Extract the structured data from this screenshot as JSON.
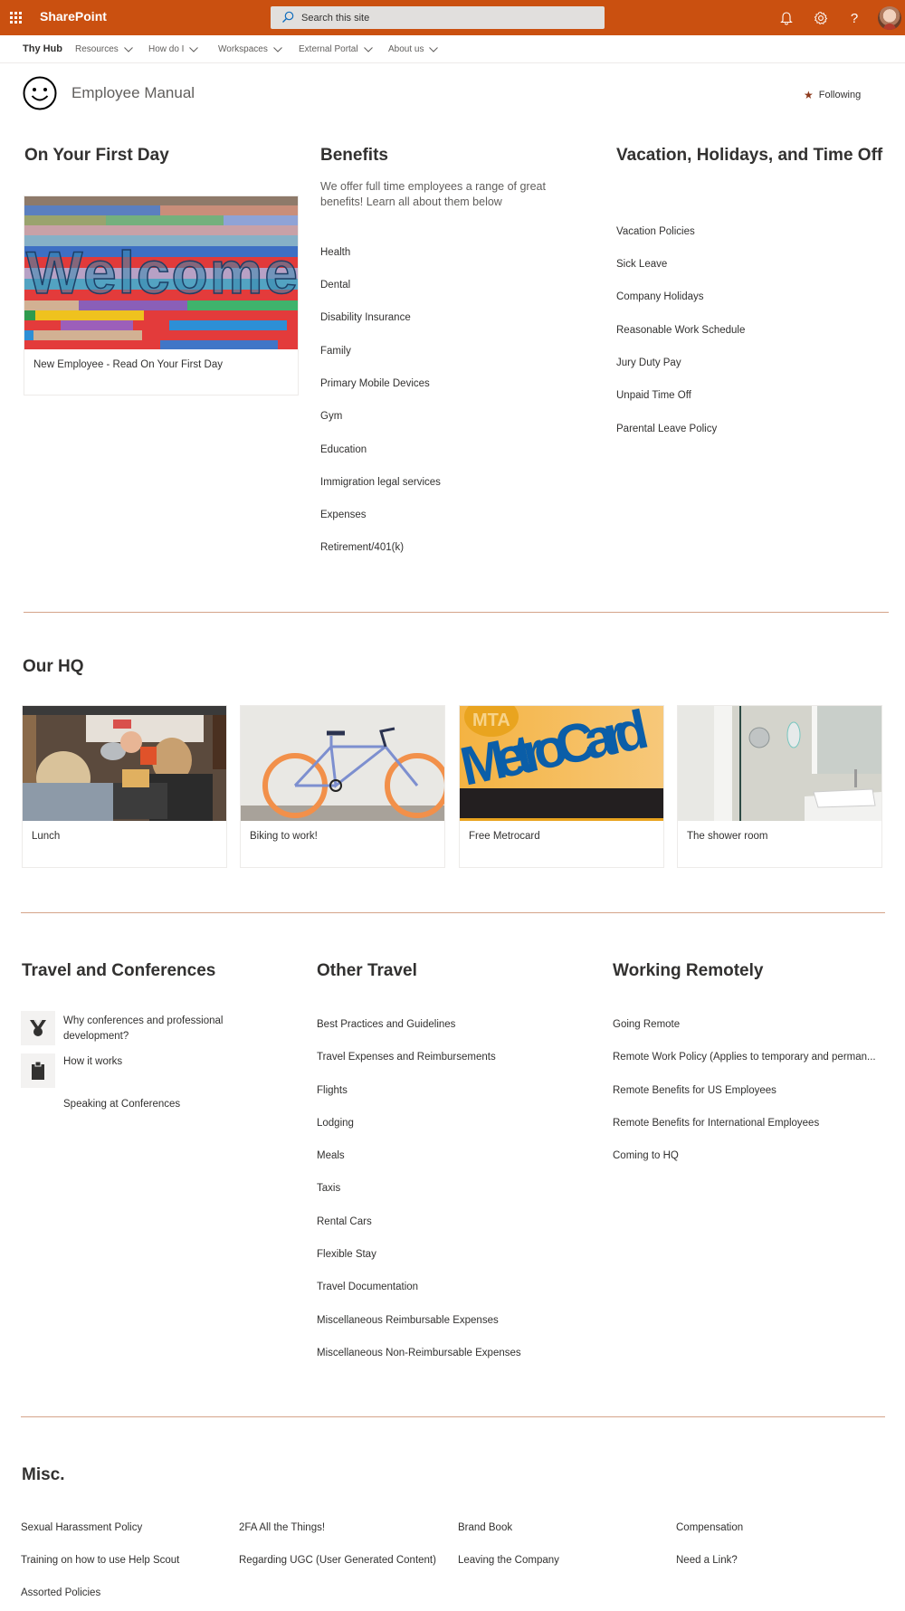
{
  "suite_bar": {
    "app_name": "SharePoint",
    "search_placeholder": "Search this site",
    "icons": [
      "app-launcher-icon",
      "search-icon",
      "notification-bell-icon",
      "settings-gear-icon",
      "help-question-icon",
      "user-avatar"
    ],
    "brand_color": "#ca5010"
  },
  "hub_nav": {
    "home": "Thy Hub",
    "items": [
      {
        "label": "Resources"
      },
      {
        "label": "How do I"
      },
      {
        "label": "Workspaces"
      },
      {
        "label": "External Portal"
      },
      {
        "label": "About us"
      }
    ]
  },
  "site_header": {
    "title": "Employee Manual",
    "logo_icon": "smiley-face-icon",
    "follow_label": "Following",
    "follow_icon": "star-filled-icon"
  },
  "first_day": {
    "heading": "On Your First Day",
    "card": {
      "caption": "New Employee - Read On Your First Day",
      "image": "Welcome colorful wooden wall"
    }
  },
  "benefits": {
    "heading": "Benefits",
    "description": "We offer full time employees a range of great benefits! Learn all about them below",
    "links": [
      "Health",
      "Dental",
      "Disability Insurance",
      "Family",
      "Primary Mobile Devices",
      "Gym",
      "Education",
      "Immigration legal services",
      "Expenses",
      "Retirement/401(k)"
    ]
  },
  "vacation": {
    "heading": "Vacation, Holidays, and Time Off",
    "links": [
      "Vacation Policies",
      "Sick Leave",
      "Company Holidays",
      "Reasonable Work Schedule",
      "Jury Duty Pay",
      "Unpaid Time Off",
      "Parental Leave Policy"
    ]
  },
  "hq": {
    "heading": "Our HQ",
    "cards": [
      {
        "caption": "Lunch",
        "image": "people eating lunch together"
      },
      {
        "caption": "Biking to work!",
        "image": "bicycle with orange tires"
      },
      {
        "caption": "Free Metrocard",
        "image": "MTA MetroCard",
        "image_text": [
          "MTA",
          "MetroCard"
        ]
      },
      {
        "caption": "The shower room",
        "image": "shower room"
      }
    ]
  },
  "travel_conferences": {
    "heading": "Travel and Conferences",
    "links": [
      {
        "label": "Why conferences and professional development?",
        "icon": "medal-icon"
      },
      {
        "label": "How it works",
        "icon": "clipboard-icon"
      },
      {
        "label": "Speaking at Conferences",
        "icon": ""
      }
    ]
  },
  "other_travel": {
    "heading": "Other Travel",
    "links": [
      "Best Practices and Guidelines",
      "Travel Expenses and Reimbursements",
      "Flights",
      "Lodging",
      "Meals",
      "Taxis",
      "Rental Cars",
      "Flexible Stay",
      "Travel Documentation",
      "Miscellaneous Reimbursable Expenses",
      "Miscellaneous Non-Reimbursable Expenses"
    ]
  },
  "working_remotely": {
    "heading": "Working Remotely",
    "links": [
      "Going Remote",
      "Remote Work Policy (Applies to temporary and perman...",
      "Remote Benefits for US Employees",
      "Remote Benefits for International Employees",
      "Coming to HQ"
    ]
  },
  "misc": {
    "heading": "Misc.",
    "links": [
      "Sexual Harassment Policy",
      "2FA All the Things!",
      "Brand Book",
      "Compensation",
      "Training on how to use Help Scout",
      "Regarding UGC (User Generated Content)",
      "Leaving the Company",
      "Need a Link?",
      "Assorted Policies"
    ]
  }
}
